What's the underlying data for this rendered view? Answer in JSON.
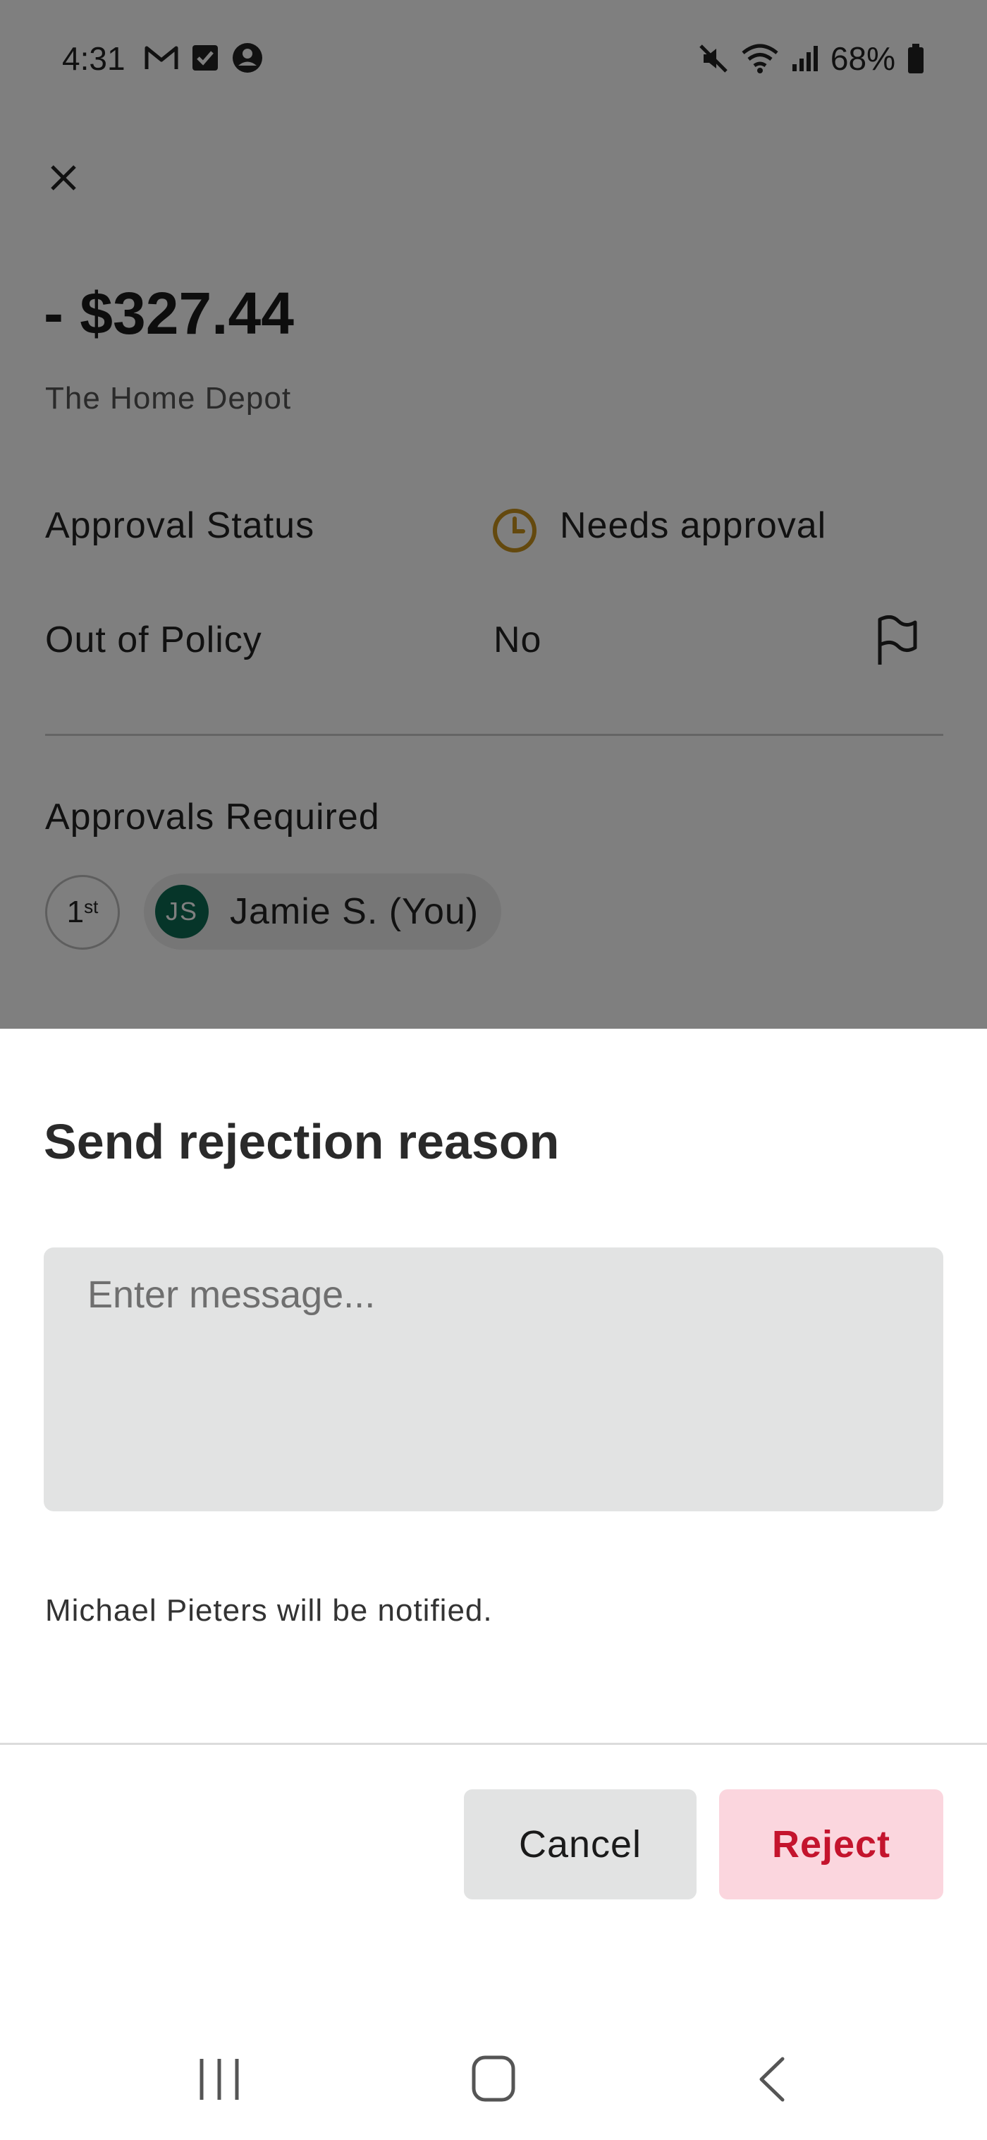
{
  "status_bar": {
    "time": "4:31",
    "battery": "68%",
    "left_icons": [
      "gmail-icon",
      "task-check-icon",
      "account-icon"
    ],
    "right_icons": [
      "mute-icon",
      "wifi-icon",
      "signal-icon",
      "battery-icon"
    ]
  },
  "transaction": {
    "amount": "- $327.44",
    "merchant": "The Home Depot",
    "approval_status_label": "Approval Status",
    "approval_status_value": "Needs approval",
    "out_of_policy_label": "Out of Policy",
    "out_of_policy_value": "No",
    "approvals_required_label": "Approvals Required",
    "approver_order": "1",
    "approver_order_suffix": "st",
    "approver_initials": "JS",
    "approver_name": "Jamie S. (You)"
  },
  "sheet": {
    "title": "Send rejection reason",
    "message_placeholder": "Enter message...",
    "message_value": "",
    "notify_text": "Michael Pieters will be notified.",
    "cancel_label": "Cancel",
    "reject_label": "Reject"
  },
  "colors": {
    "status_pending": "#c9921c",
    "avatar": "#0d6b53",
    "reject_bg": "#fbd6de",
    "reject_text": "#c4142d",
    "field_bg": "#e2e3e3"
  }
}
